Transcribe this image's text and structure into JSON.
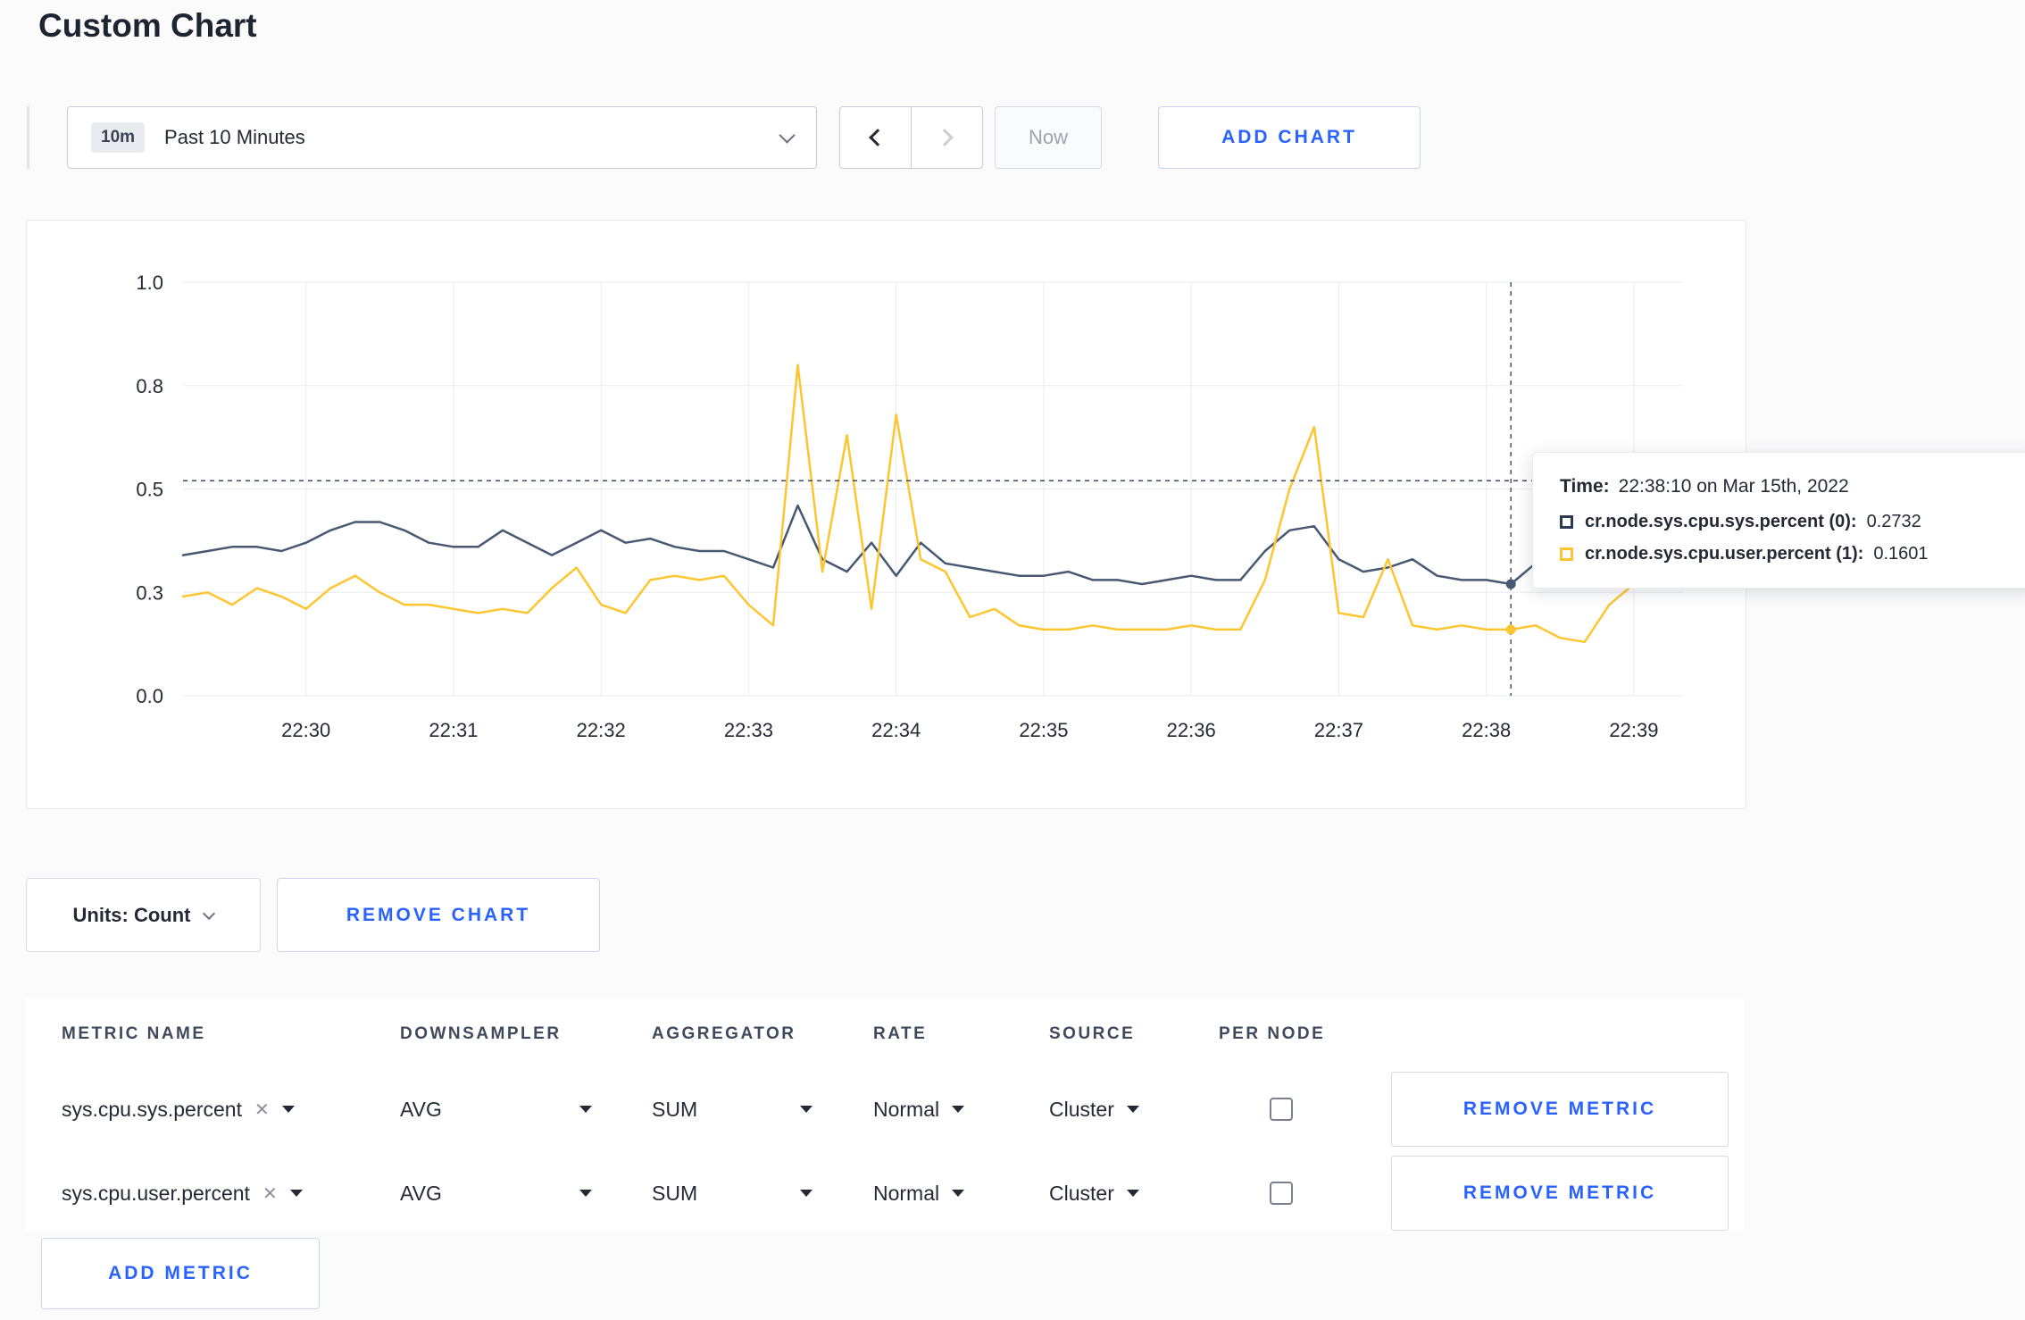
{
  "page": {
    "title": "Custom Chart"
  },
  "toolbar": {
    "time_range": {
      "badge": "10m",
      "label": "Past 10 Minutes"
    },
    "now_button": "Now",
    "add_chart_button": "ADD CHART"
  },
  "chart_data": {
    "type": "line",
    "title": "",
    "xlabel": "",
    "ylabel": "",
    "x_unit": "seconds since 22:29:10",
    "x_domain": [
      0,
      610
    ],
    "ylim": [
      0,
      1
    ],
    "grid": true,
    "x_ticks": [
      {
        "t": 50,
        "label": "22:30"
      },
      {
        "t": 110,
        "label": "22:31"
      },
      {
        "t": 170,
        "label": "22:32"
      },
      {
        "t": 230,
        "label": "22:33"
      },
      {
        "t": 290,
        "label": "22:34"
      },
      {
        "t": 350,
        "label": "22:35"
      },
      {
        "t": 410,
        "label": "22:36"
      },
      {
        "t": 470,
        "label": "22:37"
      },
      {
        "t": 530,
        "label": "22:38"
      },
      {
        "t": 590,
        "label": "22:39"
      }
    ],
    "y_ticks": [
      {
        "v": 0,
        "label": "0.0"
      },
      {
        "v": 0.25,
        "label": "0.3"
      },
      {
        "v": 0.5,
        "label": "0.5"
      },
      {
        "v": 0.75,
        "label": "0.8"
      },
      {
        "v": 1,
        "label": "1.0"
      }
    ],
    "x": [
      0,
      10,
      20,
      30,
      40,
      50,
      60,
      70,
      80,
      90,
      100,
      110,
      120,
      130,
      140,
      150,
      160,
      170,
      180,
      190,
      200,
      210,
      220,
      230,
      240,
      250,
      260,
      270,
      280,
      290,
      300,
      310,
      320,
      330,
      340,
      350,
      360,
      370,
      380,
      390,
      400,
      410,
      420,
      430,
      440,
      450,
      460,
      470,
      480,
      490,
      500,
      510,
      520,
      530,
      540,
      550,
      560,
      570,
      580,
      590
    ],
    "series": [
      {
        "name": "cr.node.sys.cpu.sys.percent (0)",
        "color": "#475872",
        "values": [
          0.34,
          0.35,
          0.36,
          0.36,
          0.35,
          0.37,
          0.4,
          0.42,
          0.42,
          0.4,
          0.37,
          0.36,
          0.36,
          0.4,
          0.37,
          0.34,
          0.37,
          0.4,
          0.37,
          0.38,
          0.36,
          0.35,
          0.35,
          0.33,
          0.31,
          0.46,
          0.33,
          0.3,
          0.37,
          0.29,
          0.37,
          0.32,
          0.31,
          0.3,
          0.29,
          0.29,
          0.3,
          0.28,
          0.28,
          0.27,
          0.28,
          0.29,
          0.28,
          0.28,
          0.35,
          0.4,
          0.41,
          0.33,
          0.3,
          0.31,
          0.33,
          0.29,
          0.28,
          0.28,
          0.27,
          0.32,
          0.3,
          0.3,
          0.31,
          0.31
        ]
      },
      {
        "name": "cr.node.sys.cpu.user.percent (1)",
        "color": "#fdc530",
        "values": [
          0.24,
          0.25,
          0.22,
          0.26,
          0.24,
          0.21,
          0.26,
          0.29,
          0.25,
          0.22,
          0.22,
          0.21,
          0.2,
          0.21,
          0.2,
          0.26,
          0.31,
          0.22,
          0.2,
          0.28,
          0.29,
          0.28,
          0.29,
          0.22,
          0.17,
          0.8,
          0.3,
          0.63,
          0.21,
          0.68,
          0.33,
          0.3,
          0.19,
          0.21,
          0.17,
          0.16,
          0.16,
          0.17,
          0.16,
          0.16,
          0.16,
          0.17,
          0.16,
          0.16,
          0.28,
          0.5,
          0.65,
          0.2,
          0.19,
          0.33,
          0.17,
          0.16,
          0.17,
          0.16,
          0.16,
          0.17,
          0.14,
          0.13,
          0.22,
          0.27
        ]
      }
    ],
    "crosshair": {
      "t": 540,
      "value": 0.52
    },
    "hover_markers": [
      {
        "series": 0,
        "t": 540,
        "v": 0.27
      },
      {
        "series": 1,
        "t": 540,
        "v": 0.16
      }
    ]
  },
  "tooltip": {
    "time_label": "Time:",
    "time_value": "22:38:10 on Mar 15th, 2022",
    "series": [
      {
        "label": "cr.node.sys.cpu.sys.percent (0):",
        "value": "0.2732",
        "swatch_color": "#2c3a52"
      },
      {
        "label": "cr.node.sys.cpu.user.percent (1):",
        "value": "0.1601",
        "swatch_color": "#fdc530"
      }
    ]
  },
  "chart_controls": {
    "units_button": "Units: Count",
    "remove_chart_button": "REMOVE CHART"
  },
  "metrics_table": {
    "headers": [
      "METRIC NAME",
      "DOWNSAMPLER",
      "AGGREGATOR",
      "RATE",
      "SOURCE",
      "PER NODE"
    ],
    "rows": [
      {
        "metric_name": "sys.cpu.sys.percent",
        "downsampler": "AVG",
        "aggregator": "SUM",
        "rate": "Normal",
        "source": "Cluster",
        "per_node_checked": false,
        "remove_button": "REMOVE METRIC"
      },
      {
        "metric_name": "sys.cpu.user.percent",
        "downsampler": "AVG",
        "aggregator": "SUM",
        "rate": "Normal",
        "source": "Cluster",
        "per_node_checked": false,
        "remove_button": "REMOVE METRIC"
      }
    ],
    "add_metric_button": "ADD METRIC"
  },
  "icons": {
    "remove_metric_x": "✕"
  },
  "colors": {
    "accent_blue": "#2962ff",
    "series_sys": "#475872",
    "series_user": "#fdc530",
    "grid": "#e9ebef",
    "crosshair": "#3d4a5f"
  }
}
